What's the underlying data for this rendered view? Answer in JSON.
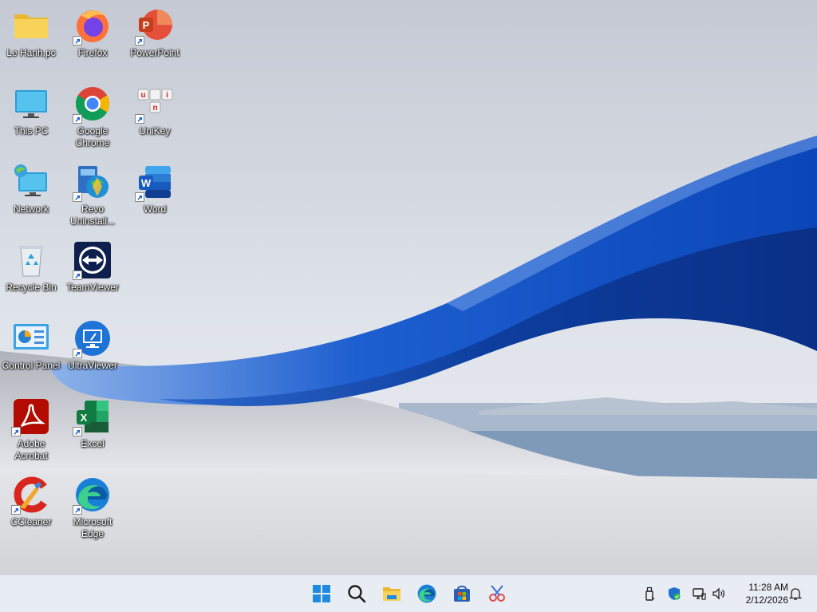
{
  "desktop": {
    "icons": [
      {
        "label": "Le Hanh.pc",
        "icon": "folder-icon"
      },
      {
        "label": "Firefox",
        "icon": "firefox-icon"
      },
      {
        "label": "PowerPoint",
        "icon": "powerpoint-icon"
      },
      {
        "label": "This PC",
        "icon": "this-pc-icon"
      },
      {
        "label": "Google Chrome",
        "icon": "chrome-icon"
      },
      {
        "label": "UniKey",
        "icon": "unikey-icon"
      },
      {
        "label": "Network",
        "icon": "network-icon"
      },
      {
        "label": "Revo Uninstall...",
        "icon": "revo-uninstaller-icon"
      },
      {
        "label": "Word",
        "icon": "word-icon"
      },
      {
        "label": "Recycle Bin",
        "icon": "recycle-bin-icon"
      },
      {
        "label": "TeamViewer",
        "icon": "teamviewer-icon"
      },
      {
        "label": "Control Panel",
        "icon": "control-panel-icon"
      },
      {
        "label": "UltraViewer",
        "icon": "ultraviewer-icon"
      },
      {
        "label": "Adobe Acrobat",
        "icon": "acrobat-icon"
      },
      {
        "label": "Excel",
        "icon": "excel-icon"
      },
      {
        "label": "CCleaner",
        "icon": "ccleaner-icon"
      },
      {
        "label": "Microsoft Edge",
        "icon": "edge-icon"
      }
    ]
  },
  "taskbar": {
    "pinned": [
      "start-icon",
      "search-icon",
      "file-explorer-icon",
      "edge-icon",
      "microsoft-store-icon",
      "snipping-tool-icon"
    ],
    "tray": [
      "usb-icon",
      "defender-icon",
      "network-icon",
      "volume-icon",
      "notification-bell-icon"
    ],
    "clock": {
      "time": "11:28 AM",
      "date": "2/12/2026"
    }
  },
  "colors": {
    "wallpaper_blue": "#1f5fd1",
    "taskbar_bg": "#e8ecf3",
    "label_text": "#ffffff"
  }
}
